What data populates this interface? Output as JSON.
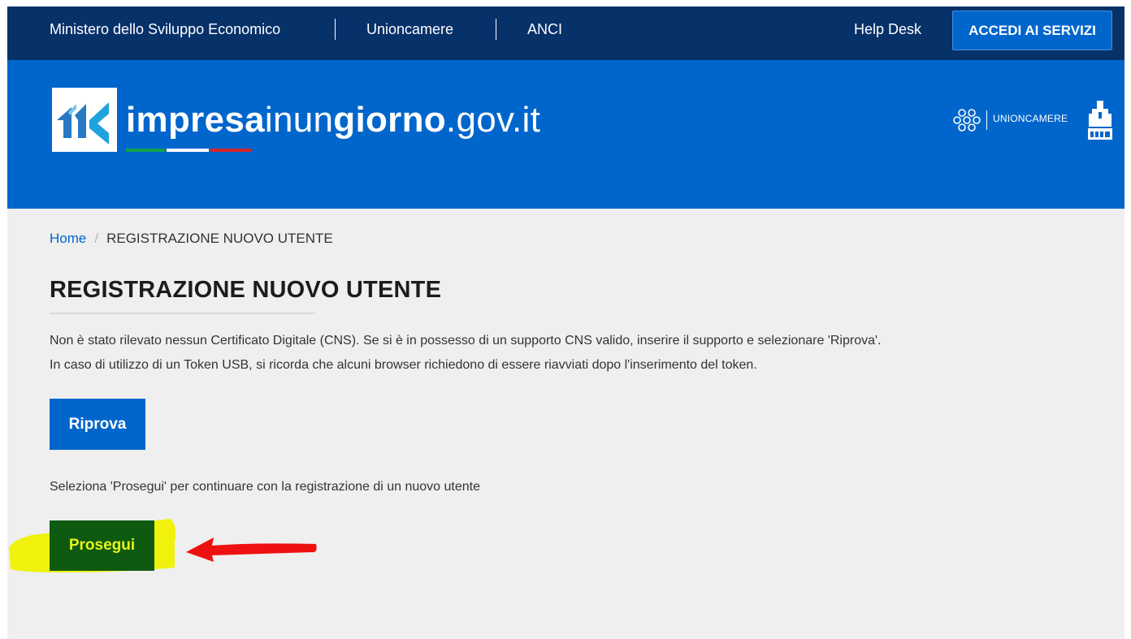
{
  "topbar": {
    "links": [
      "Ministero dello Sviluppo Economico",
      "Unioncamere",
      "ANCI"
    ],
    "helpdesk": "Help Desk",
    "accedi": "ACCEDI AI SERVIZI",
    "bg_color": "#063169"
  },
  "header": {
    "logo_text_bold1": "impresa",
    "logo_text_thin1": "inun",
    "logo_text_bold2": "giorno",
    "logo_text_thin2": ".gov.it",
    "partner_label": "UNIONCAMERE",
    "bg_color": "#0066cc"
  },
  "breadcrumb": {
    "home": "Home",
    "separator": "/",
    "current": "REGISTRAZIONE NUOVO UTENTE"
  },
  "main": {
    "title": "REGISTRAZIONE NUOVO UTENTE",
    "paragraph1": "Non è stato rilevato nessun Certificato Digitale (CNS). Se si è in possesso di un supporto CNS valido, inserire il supporto e selezionare 'Riprova'.",
    "paragraph2": "In caso di utilizzo di un Token USB, si ricorda che alcuni browser richiedono di essere riavviati dopo l'inserimento del token.",
    "riprova_label": "Riprova",
    "prosegui_hint": "Seleziona 'Prosegui' per continuare con la registrazione di un nuovo utente",
    "prosegui_label": "Prosegui"
  },
  "annotation": {
    "highlight_color": "#f0f20e",
    "arrow_color": "#ee1111"
  }
}
